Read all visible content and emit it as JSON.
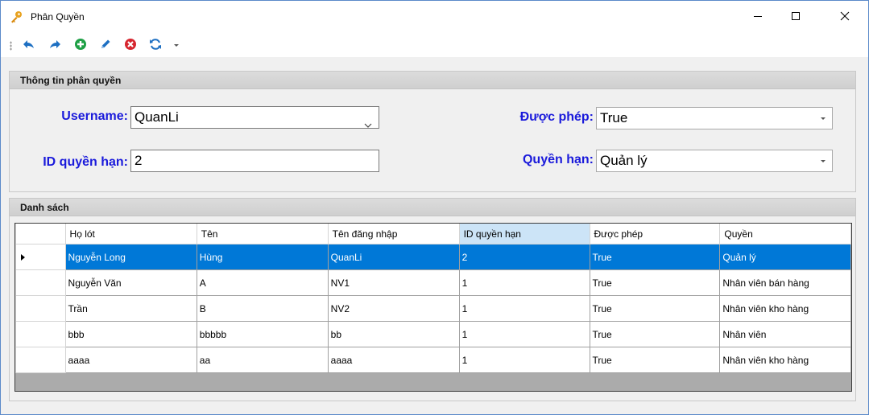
{
  "window": {
    "title": "Phân Quyền",
    "icon": "key-icon"
  },
  "titlebar_controls": {
    "minimize": "minimize-icon",
    "maximize": "maximize-icon",
    "close": "close-icon"
  },
  "toolbar": {
    "buttons": [
      "undo-icon",
      "redo-icon",
      "add-icon",
      "edit-icon",
      "delete-icon",
      "refresh-icon",
      "dropdown-icon"
    ],
    "colors": {
      "nav": "#1d6fc2",
      "add": "#1fa046",
      "delete": "#d6262f"
    }
  },
  "info_group": {
    "title": "Thông tin phân quyền",
    "username_label": "Username:",
    "username_value": "QuanLi",
    "id_label": "ID quyền hạn:",
    "id_value": "2",
    "allowed_label": "Được phép:",
    "allowed_value": "True",
    "role_label": "Quyền hạn:",
    "role_value": "Quản lý",
    "label_color": "#1a1adb"
  },
  "list_group": {
    "title": "Danh sách",
    "columns": [
      "Họ lót",
      "Tên",
      "Tên đăng nhập",
      "ID quyền hạn",
      "Được phép",
      "Quyền"
    ],
    "rows": [
      [
        "Nguyễn Long",
        "Hùng",
        "QuanLi",
        "2",
        "True",
        "Quản lý"
      ],
      [
        "Nguyễn Văn",
        "A",
        "NV1",
        "1",
        "True",
        "Nhân viên bán hàng"
      ],
      [
        "Trần",
        "B",
        "NV2",
        "1",
        "True",
        "Nhân viên kho hàng"
      ],
      [
        "bbb",
        "bbbbb",
        "bb",
        "1",
        "True",
        "Nhân viên"
      ],
      [
        "aaaa",
        "aa",
        "aaaa",
        "1",
        "True",
        "Nhân viên kho hàng"
      ]
    ],
    "selected_row": 0,
    "selection_color": "#0078d7"
  }
}
